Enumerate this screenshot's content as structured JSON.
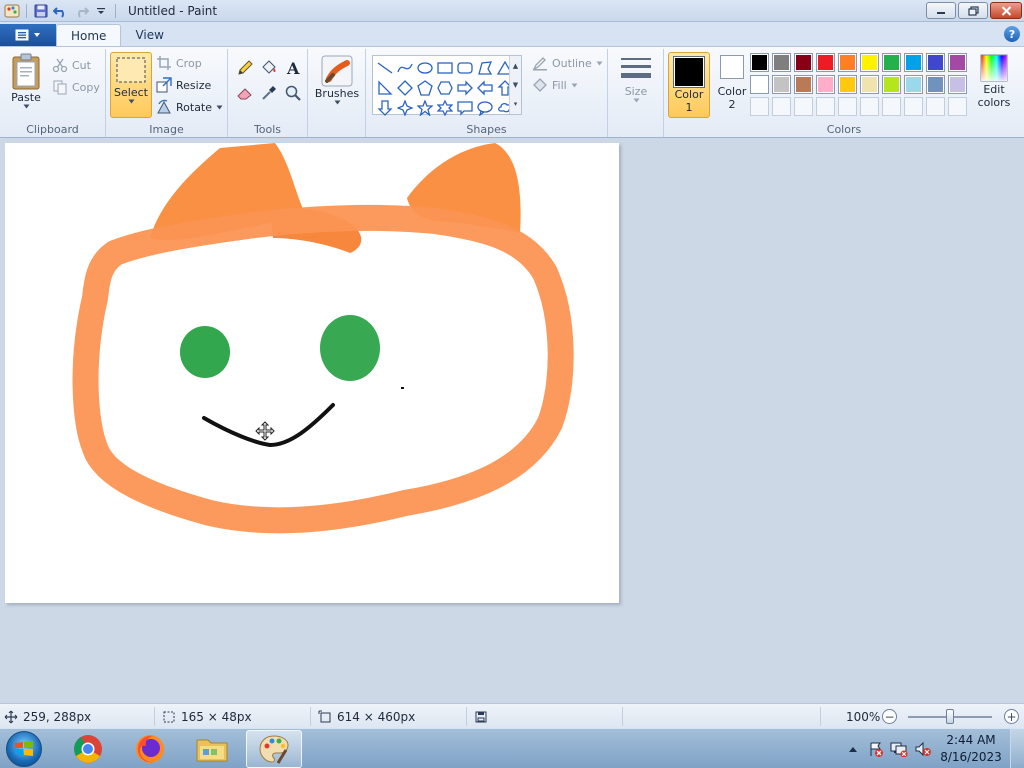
{
  "window": {
    "title": "Untitled - Paint",
    "menu_icon": "paint-menu-icon"
  },
  "tabs": [
    {
      "label": "Home",
      "active": true
    },
    {
      "label": "View",
      "active": false
    }
  ],
  "ribbon": {
    "clipboard": {
      "label": "Clipboard",
      "paste": "Paste",
      "cut": "Cut",
      "copy": "Copy"
    },
    "image": {
      "label": "Image",
      "select": "Select",
      "crop": "Crop",
      "resize": "Resize",
      "rotate": "Rotate"
    },
    "tools": {
      "label": "Tools"
    },
    "brushes": {
      "label": "Brushes"
    },
    "shapes": {
      "label": "Shapes",
      "outline": "Outline",
      "fill": "Fill"
    },
    "size": {
      "label": "Size"
    },
    "colors": {
      "label": "Colors",
      "color1_label": "Color",
      "color1_num": "1",
      "color2_label": "Color",
      "color2_num": "2",
      "color1_value": "#000000",
      "color2_value": "#ffffff",
      "edit_colors_1": "Edit",
      "edit_colors_2": "colors",
      "palette": [
        "#000000",
        "#7f7f7f",
        "#880015",
        "#ed1c24",
        "#ff7f27",
        "#fff200",
        "#22b14c",
        "#00a2e8",
        "#3f48cc",
        "#a349a4",
        "#ffffff",
        "#c3c3c3",
        "#b97a57",
        "#ffaec9",
        "#ffc90e",
        "#efe4b0",
        "#b5e61d",
        "#99d9ea",
        "#7092be",
        "#c8bfe7"
      ]
    }
  },
  "status": {
    "cursor_pos": "259, 288px",
    "selection_size": "165 × 48px",
    "image_size": "614 × 460px",
    "zoom": "100%"
  },
  "taskbar": {
    "time": "2:44 AM",
    "date": "8/16/2023"
  }
}
